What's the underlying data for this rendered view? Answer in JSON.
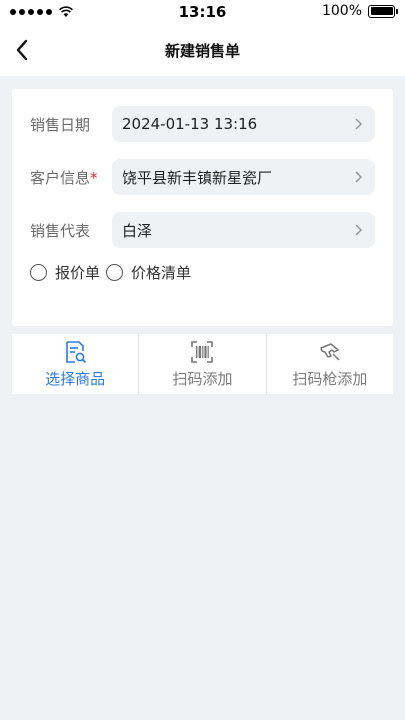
{
  "status_bar": {
    "time": "13:16",
    "battery_percent": "100%"
  },
  "navbar": {
    "title": "新建销售单",
    "back_icon": "chevron-left-icon"
  },
  "form": {
    "rows": [
      {
        "label": "销售日期",
        "required": false,
        "value": "2024-01-13 13:16"
      },
      {
        "label": "客户信息",
        "required": true,
        "value": "饶平县新丰镇新星瓷厂"
      },
      {
        "label": "销售代表",
        "required": false,
        "value": "白泽"
      }
    ],
    "required_mark": "*",
    "radios": [
      {
        "label": "报价单",
        "selected": false
      },
      {
        "label": "价格清单",
        "selected": false
      }
    ]
  },
  "actions": [
    {
      "label": "选择商品",
      "icon": "document-search-icon",
      "active": true
    },
    {
      "label": "扫码添加",
      "icon": "barcode-scan-icon",
      "active": false
    },
    {
      "label": "扫码枪添加",
      "icon": "scanner-gun-icon",
      "active": false
    }
  ],
  "colors": {
    "accent": "#2b7be4",
    "required": "#e0272a",
    "background": "#f0f1f5"
  }
}
